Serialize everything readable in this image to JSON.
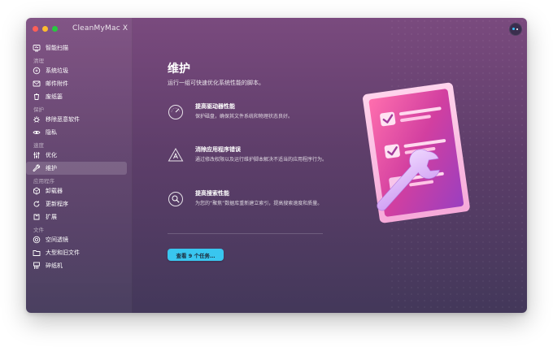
{
  "window": {
    "app_title": "CleanMyMac X"
  },
  "sidebar": {
    "top_item": {
      "label": "智能扫描",
      "icon": "smart-scan-icon"
    },
    "sections": [
      {
        "label": "清理",
        "items": [
          {
            "label": "系统垃圾",
            "icon": "system-junk-icon"
          },
          {
            "label": "邮件附件",
            "icon": "mail-attachments-icon"
          },
          {
            "label": "废纸篓",
            "icon": "trash-icon"
          }
        ]
      },
      {
        "label": "保护",
        "items": [
          {
            "label": "移除恶意软件",
            "icon": "malware-icon"
          },
          {
            "label": "隐私",
            "icon": "privacy-icon"
          }
        ]
      },
      {
        "label": "速度",
        "items": [
          {
            "label": "优化",
            "icon": "optimization-icon"
          },
          {
            "label": "维护",
            "icon": "maintenance-icon",
            "active": true
          }
        ]
      },
      {
        "label": "应用程序",
        "items": [
          {
            "label": "卸载器",
            "icon": "uninstaller-icon"
          },
          {
            "label": "更新程序",
            "icon": "updater-icon"
          },
          {
            "label": "扩展",
            "icon": "extensions-icon"
          }
        ]
      },
      {
        "label": "文件",
        "items": [
          {
            "label": "空间透镜",
            "icon": "space-lens-icon"
          },
          {
            "label": "大型和旧文件",
            "icon": "large-old-files-icon"
          },
          {
            "label": "碎纸机",
            "icon": "shredder-icon"
          }
        ]
      }
    ]
  },
  "main": {
    "title": "维护",
    "subtitle": "运行一组可快速优化系统性能的脚本。",
    "features": [
      {
        "icon": "disk-performance-icon",
        "title": "提高驱动器性能",
        "desc": "保护磁盘，确保其文件系统和物理状态良好。"
      },
      {
        "icon": "warning-triangle-icon",
        "title": "消除应用程序错误",
        "desc": "通过修改权限以及运行维护脚本解决不适当的应用程序行为。"
      },
      {
        "icon": "search-magnifier-icon",
        "title": "提高搜索性能",
        "desc": "为您的“聚焦”数据库重新建立索引，提高搜索速度和质量。"
      }
    ],
    "cta_label": "查看 9 个任务…"
  },
  "colors": {
    "accent": "#39c6ef",
    "window_top": "#7a4a7e",
    "window_bottom": "#43385a"
  }
}
